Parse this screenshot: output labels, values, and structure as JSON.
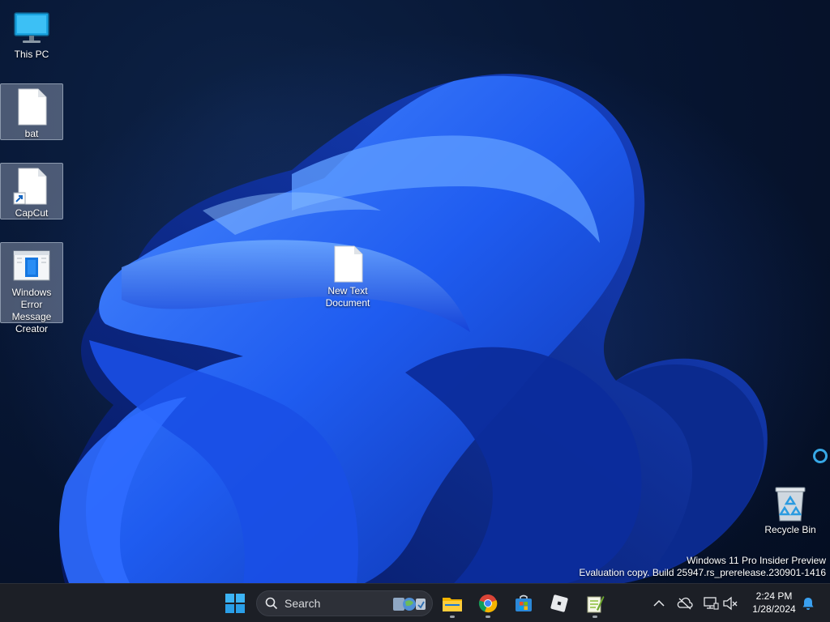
{
  "desktop": {
    "icons": [
      {
        "label": "This PC",
        "icon": "monitor-icon"
      },
      {
        "label": "bat",
        "icon": "blank-file-icon"
      },
      {
        "label": "CapCut",
        "icon": "shortcut-file-icon"
      },
      {
        "label": "Windows Error Message Creator",
        "icon": "app-window-icon"
      },
      {
        "label": "New Text Document",
        "icon": "text-file-icon"
      },
      {
        "label": "Recycle Bin",
        "icon": "recycle-bin-icon"
      }
    ],
    "watermark": {
      "line1": "Windows 11 Pro Insider Preview",
      "line2": "Evaluation copy. Build 25947.rs_prerelease.230901-1416"
    }
  },
  "taskbar": {
    "search_placeholder": "Search",
    "pinned": [
      {
        "name": "File Explorer",
        "icon": "folder-icon"
      },
      {
        "name": "Google Chrome",
        "icon": "chrome-icon"
      },
      {
        "name": "Microsoft Store",
        "icon": "store-icon"
      },
      {
        "name": "Roblox",
        "icon": "roblox-icon"
      },
      {
        "name": "Notepad++",
        "icon": "notepad-plus-icon"
      }
    ],
    "tray": {
      "icons": [
        "chevron-up-icon",
        "cloud-offline-icon",
        "network-icon",
        "volume-muted-icon",
        "notification-bell-icon"
      ],
      "time": "2:24 PM",
      "date": "1/28/2024"
    }
  },
  "colors": {
    "taskbar_bg": "#1c1f26",
    "accent": "#0078d4",
    "wallpaper_bloom": "#1f5cf0"
  }
}
